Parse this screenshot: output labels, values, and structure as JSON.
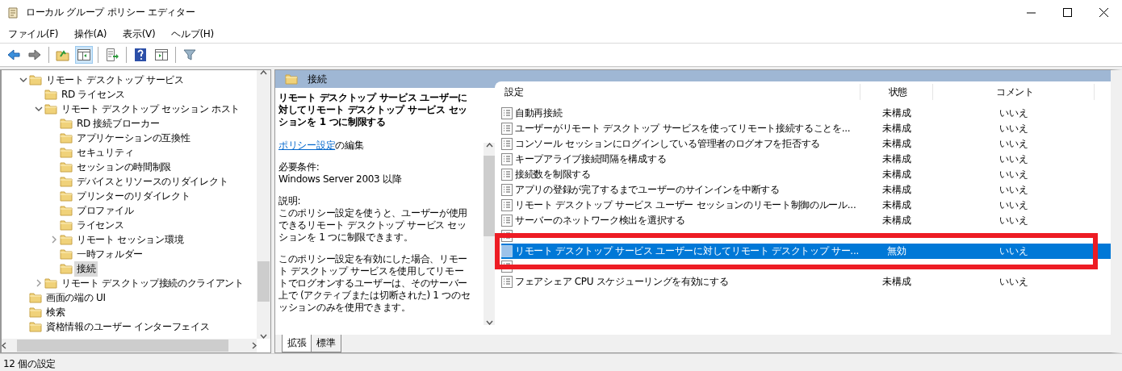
{
  "window": {
    "title": "ローカル グループ ポリシー エディター"
  },
  "menu": [
    {
      "label": "ファイル(F)"
    },
    {
      "label": "操作(A)"
    },
    {
      "label": "表示(V)"
    },
    {
      "label": "ヘルプ(H)"
    }
  ],
  "toolbar": [
    {
      "kind": "back",
      "pressed": false
    },
    {
      "kind": "forward",
      "pressed": false
    },
    {
      "kind": "sep"
    },
    {
      "kind": "up",
      "pressed": false
    },
    {
      "kind": "tree",
      "pressed": true
    },
    {
      "kind": "sep"
    },
    {
      "kind": "export",
      "pressed": false
    },
    {
      "kind": "sep"
    },
    {
      "kind": "help",
      "pressed": false
    },
    {
      "kind": "action",
      "pressed": false
    },
    {
      "kind": "sep"
    },
    {
      "kind": "filter",
      "pressed": false
    }
  ],
  "tree": [
    {
      "label": "リモート デスクトップ サービス",
      "expanded": true,
      "selected": false,
      "children": [
        {
          "label": "RD ライセンス",
          "selected": false
        },
        {
          "label": "リモート デスクトップ セッション ホスト",
          "expanded": true,
          "selected": false,
          "children": [
            {
              "label": "RD 接続ブローカー",
              "selected": false
            },
            {
              "label": "アプリケーションの互換性",
              "selected": false
            },
            {
              "label": "セキュリティ",
              "selected": false
            },
            {
              "label": "セッションの時間制限",
              "selected": false
            },
            {
              "label": "デバイスとリソースのリダイレクト",
              "selected": false
            },
            {
              "label": "プリンターのリダイレクト",
              "selected": false
            },
            {
              "label": "プロファイル",
              "selected": false
            },
            {
              "label": "ライセンス",
              "selected": false
            },
            {
              "label": "リモート セッション環境",
              "expanded": false,
              "selected": false
            },
            {
              "label": "一時フォルダー",
              "selected": false
            },
            {
              "label": "接続",
              "selected": true
            }
          ]
        },
        {
          "label": "リモート デスクトップ接続のクライアント",
          "expanded": false,
          "selected": false
        }
      ]
    },
    {
      "label": "画面の端の UI",
      "selected": false
    },
    {
      "label": "検索",
      "selected": false
    },
    {
      "label": "資格情報のユーザー インターフェイス",
      "selected": false
    }
  ],
  "details": {
    "header": "接続",
    "title": "リモート デスクトップ サービス ユーザーに対してリモート デスクトップ サービス セッションを 1 つに制限する",
    "edit_link": "ポリシー設定",
    "edit_rest": "の編集",
    "requirements_label": "必要条件:",
    "requirements": "Windows Server 2003 以降",
    "description_label": "説明:",
    "paragraphs": [
      "このポリシー設定を使うと、ユーザーが使用できるリモート デスクトップ サービス セッションを 1 つに制限できます。",
      "このポリシー設定を有効にした場合、リモート デスクトップ サービスを使用してリモートでログオンするユーザーは、そのサーバー上で (アクティブまたは切断された) 1 つのセッションのみを使用できます。"
    ]
  },
  "table": {
    "columns": [
      "設定",
      "状態",
      "コメント"
    ],
    "rows": [
      {
        "kind": "setting",
        "name": "自動再接続",
        "state": "未構成",
        "comment": "いいえ",
        "selected": false
      },
      {
        "kind": "setting",
        "name": "ユーザーがリモート デスクトップ サービスを使ってリモート接続することを...",
        "state": "未構成",
        "comment": "いいえ",
        "selected": false
      },
      {
        "kind": "setting",
        "name": "コンソール セッションにログインしている管理者のログオフを拒否する",
        "state": "未構成",
        "comment": "いいえ",
        "selected": false
      },
      {
        "kind": "setting",
        "name": "キープアライブ接続間隔を構成する",
        "state": "未構成",
        "comment": "いいえ",
        "selected": false
      },
      {
        "kind": "setting",
        "name": "接続数を制限する",
        "state": "未構成",
        "comment": "いいえ",
        "selected": false
      },
      {
        "kind": "setting",
        "name": "アプリの登録が完了するまでユーザーのサインインを中断する",
        "state": "未構成",
        "comment": "いいえ",
        "selected": false
      },
      {
        "kind": "setting",
        "name": "リモート デスクトップ サービス ユーザー セッションのリモート制御のルール...",
        "state": "未構成",
        "comment": "いいえ",
        "selected": false
      },
      {
        "kind": "setting",
        "name": "サーバーのネットワーク検出を選択する",
        "state": "未構成",
        "comment": "いいえ",
        "selected": false
      },
      {
        "kind": "obscured",
        "selected": false
      },
      {
        "kind": "setting",
        "name": "リモート デスクトップ サービス ユーザーに対してリモート デスクトップ サー...",
        "state": "無効",
        "comment": "いいえ",
        "selected": true
      },
      {
        "kind": "obscured",
        "selected": false
      },
      {
        "kind": "setting",
        "name": "フェアシェア CPU スケジューリングを有効にする",
        "state": "未構成",
        "comment": "いいえ",
        "selected": false
      }
    ]
  },
  "tabs": [
    {
      "label": "拡張",
      "selected": true
    },
    {
      "label": "標準",
      "selected": false
    }
  ],
  "status_bar": "12 個の設定"
}
